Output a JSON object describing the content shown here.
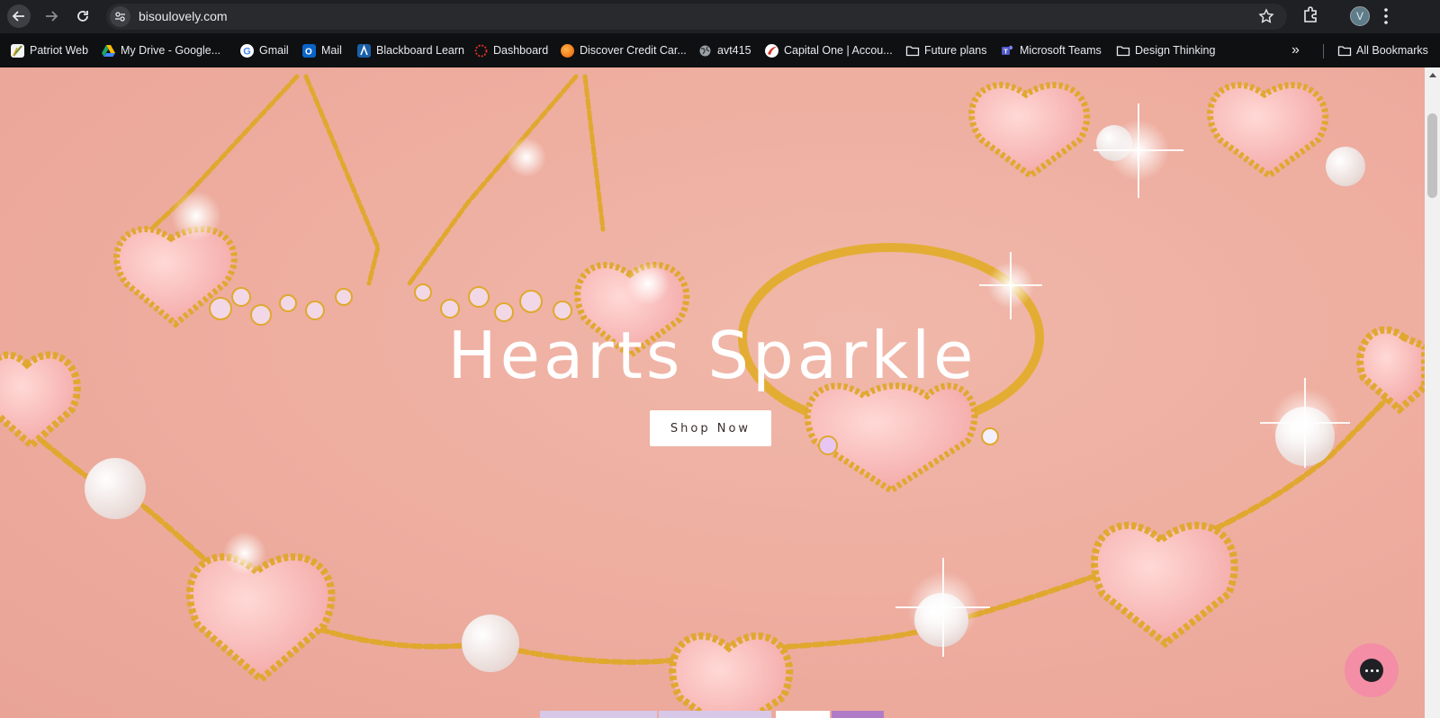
{
  "browser": {
    "url": "bisoulovely.com",
    "profile_initial": "V",
    "icons": {
      "back": "arrow-left-icon",
      "forward": "arrow-right-icon",
      "reload": "reload-icon",
      "site_info": "tune-icon",
      "bookmark_star": "star-icon",
      "extensions": "puzzle-icon",
      "menu": "kebab-icon"
    }
  },
  "bookmarks": {
    "items": [
      {
        "label": "Patriot Web",
        "icon": "patriot-web-icon"
      },
      {
        "label": "My Drive - Google...",
        "icon": "google-drive-icon"
      },
      {
        "label": "Gmail",
        "icon": "google-icon"
      },
      {
        "label": "Mail",
        "icon": "outlook-icon"
      },
      {
        "label": "Blackboard Learn",
        "icon": "blackboard-icon"
      },
      {
        "label": "Dashboard",
        "icon": "dashboard-icon"
      },
      {
        "label": "Discover Credit Car...",
        "icon": "discover-icon"
      },
      {
        "label": "avt415",
        "icon": "globe-icon"
      },
      {
        "label": "Capital One | Accou...",
        "icon": "capital-one-icon"
      },
      {
        "label": "Future plans",
        "icon": "folder-icon"
      },
      {
        "label": "Microsoft Teams",
        "icon": "teams-icon"
      },
      {
        "label": "Design Thinking",
        "icon": "folder-icon"
      }
    ],
    "more": "»",
    "all_bookmarks": "All Bookmarks"
  },
  "hero": {
    "headline": "Hearts Sparkle",
    "cta": "Shop Now"
  },
  "chat": {
    "icon": "chat-bubble-icon"
  },
  "colors": {
    "hero_bg": "#eeaea0",
    "chat_button": "#f38ea6",
    "gold": "#e0a82e"
  }
}
